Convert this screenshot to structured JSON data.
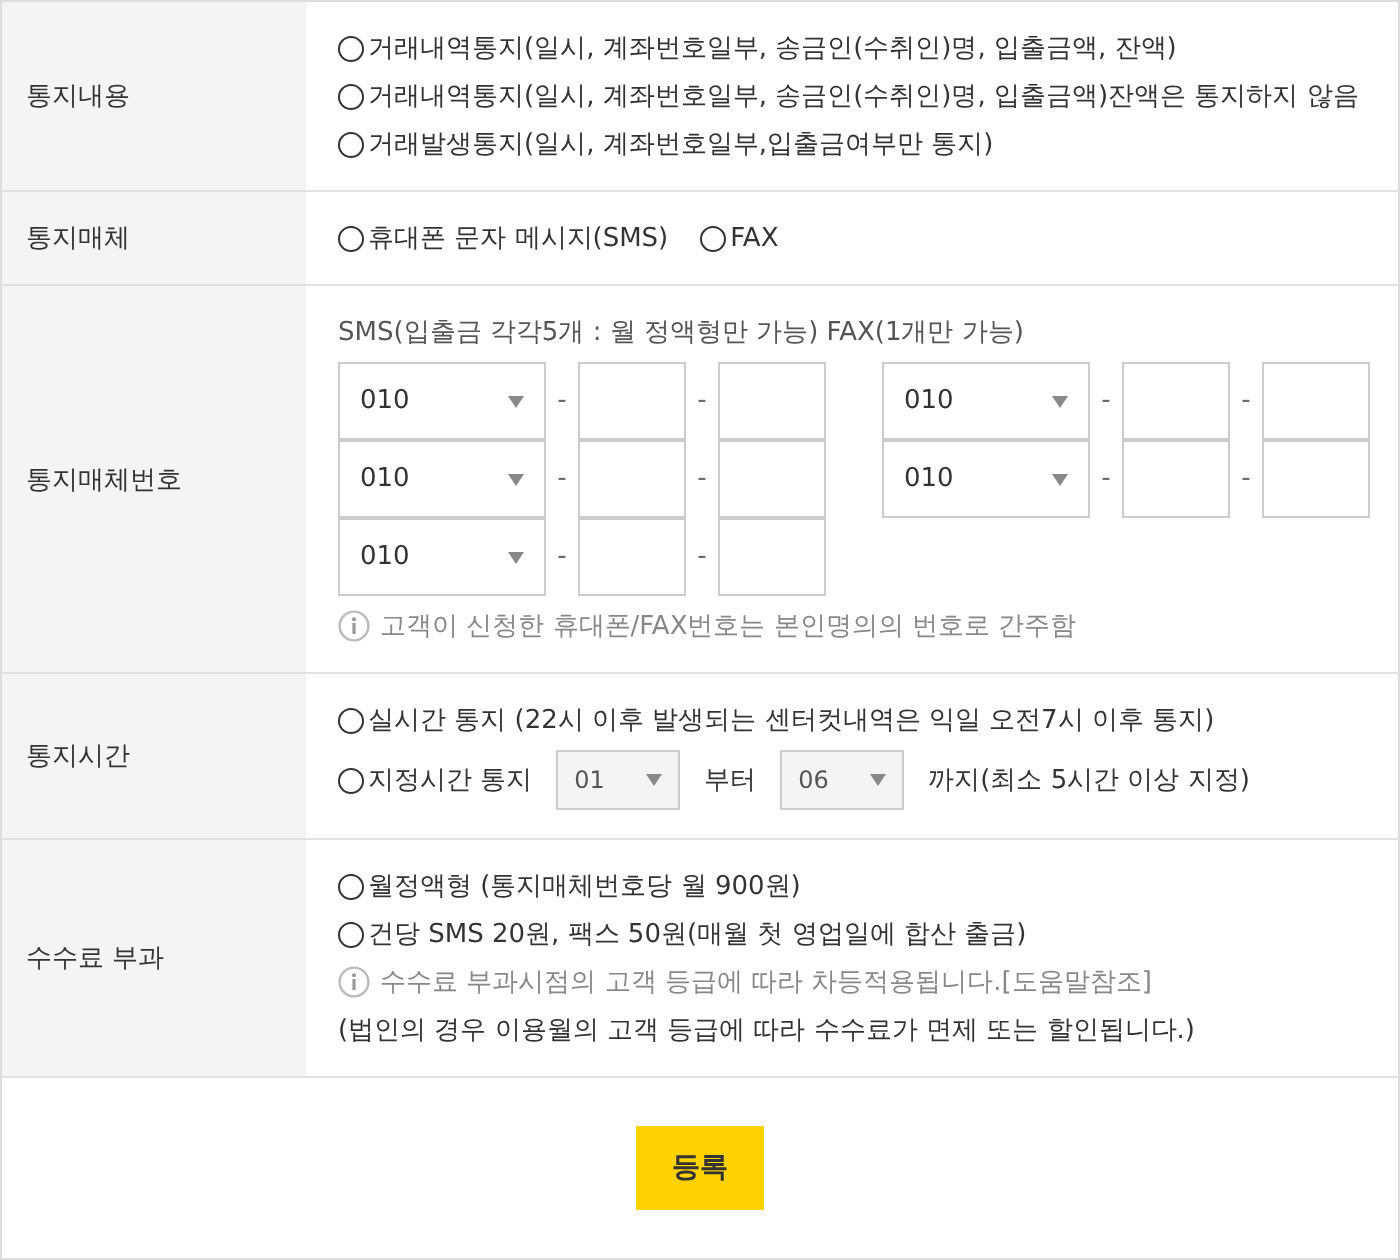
{
  "rows": [
    {
      "kind": "radiostack",
      "label": "통지내용",
      "options": [
        {
          "label": "거래내역통지(일시, 계좌번호일부, 송금인(수취인)명, 입출금액, 잔액)",
          "selected": false
        },
        {
          "label": "거래내역통지(일시, 계좌번호일부, 송금인(수취인)명, 입출금액)잔액은 통지하지 않음",
          "selected": false
        },
        {
          "label": "거래발생통지(일시, 계좌번호일부,입출금여부만 통지)",
          "selected": false
        }
      ]
    },
    {
      "kind": "radioline",
      "label": "통지매체",
      "options": [
        {
          "label": "휴대폰 문자 메시지(SMS)",
          "selected": false
        },
        {
          "label": "FAX",
          "selected": false
        }
      ]
    },
    {
      "kind": "phones",
      "label": "통지매체번호",
      "caption": "SMS(입출금 각각5개 : 월 정액형만 가능) FAX(1개만 가능)",
      "groups": [
        [
          {
            "area": "010",
            "sep1": "-",
            "sep2": "-"
          },
          {
            "area": "010",
            "sep1": "-",
            "sep2": "-"
          },
          {
            "area": "010",
            "sep1": "-",
            "sep2": "-"
          }
        ],
        [
          {
            "area": "010",
            "sep1": "-",
            "sep2": "-"
          },
          {
            "area": "010",
            "sep1": "-",
            "sep2": "-"
          }
        ]
      ],
      "note": "고객이 신청한 휴대폰/FAX번호는 본인명의의 번호로 간주함"
    },
    {
      "kind": "time",
      "label": "통지시간",
      "realtime": {
        "label": "실시간 통지 (22시 이후 발생되는 센터컷내역은 익일 오전7시 이후 통지)",
        "selected": false
      },
      "scheduled": {
        "label": "지정시간 통지",
        "selected": false,
        "from": {
          "value": "01",
          "disabled": true
        },
        "from_suffix": "부터",
        "to": {
          "value": "06",
          "disabled": true
        },
        "to_suffix": "까지(최소 5시간 이상 지정)"
      }
    },
    {
      "kind": "fee",
      "label": "수수료 부과",
      "options": [
        {
          "label": "월정액형 (통지매체번호당 월 900원)",
          "selected": false
        },
        {
          "label": "건당 SMS 20원, 팩스 50원(매월 첫 영업일에 합산 출금)",
          "selected": false
        }
      ],
      "note": "수수료 부과시점의 고객 등급에 따라 차등적용됩니다.[도움말참조]",
      "remark": "(법인의 경우 이용월의 고객 등급에 따라 수수료가 면제 또는 할인됩니다.)"
    }
  ],
  "submit": "등록"
}
